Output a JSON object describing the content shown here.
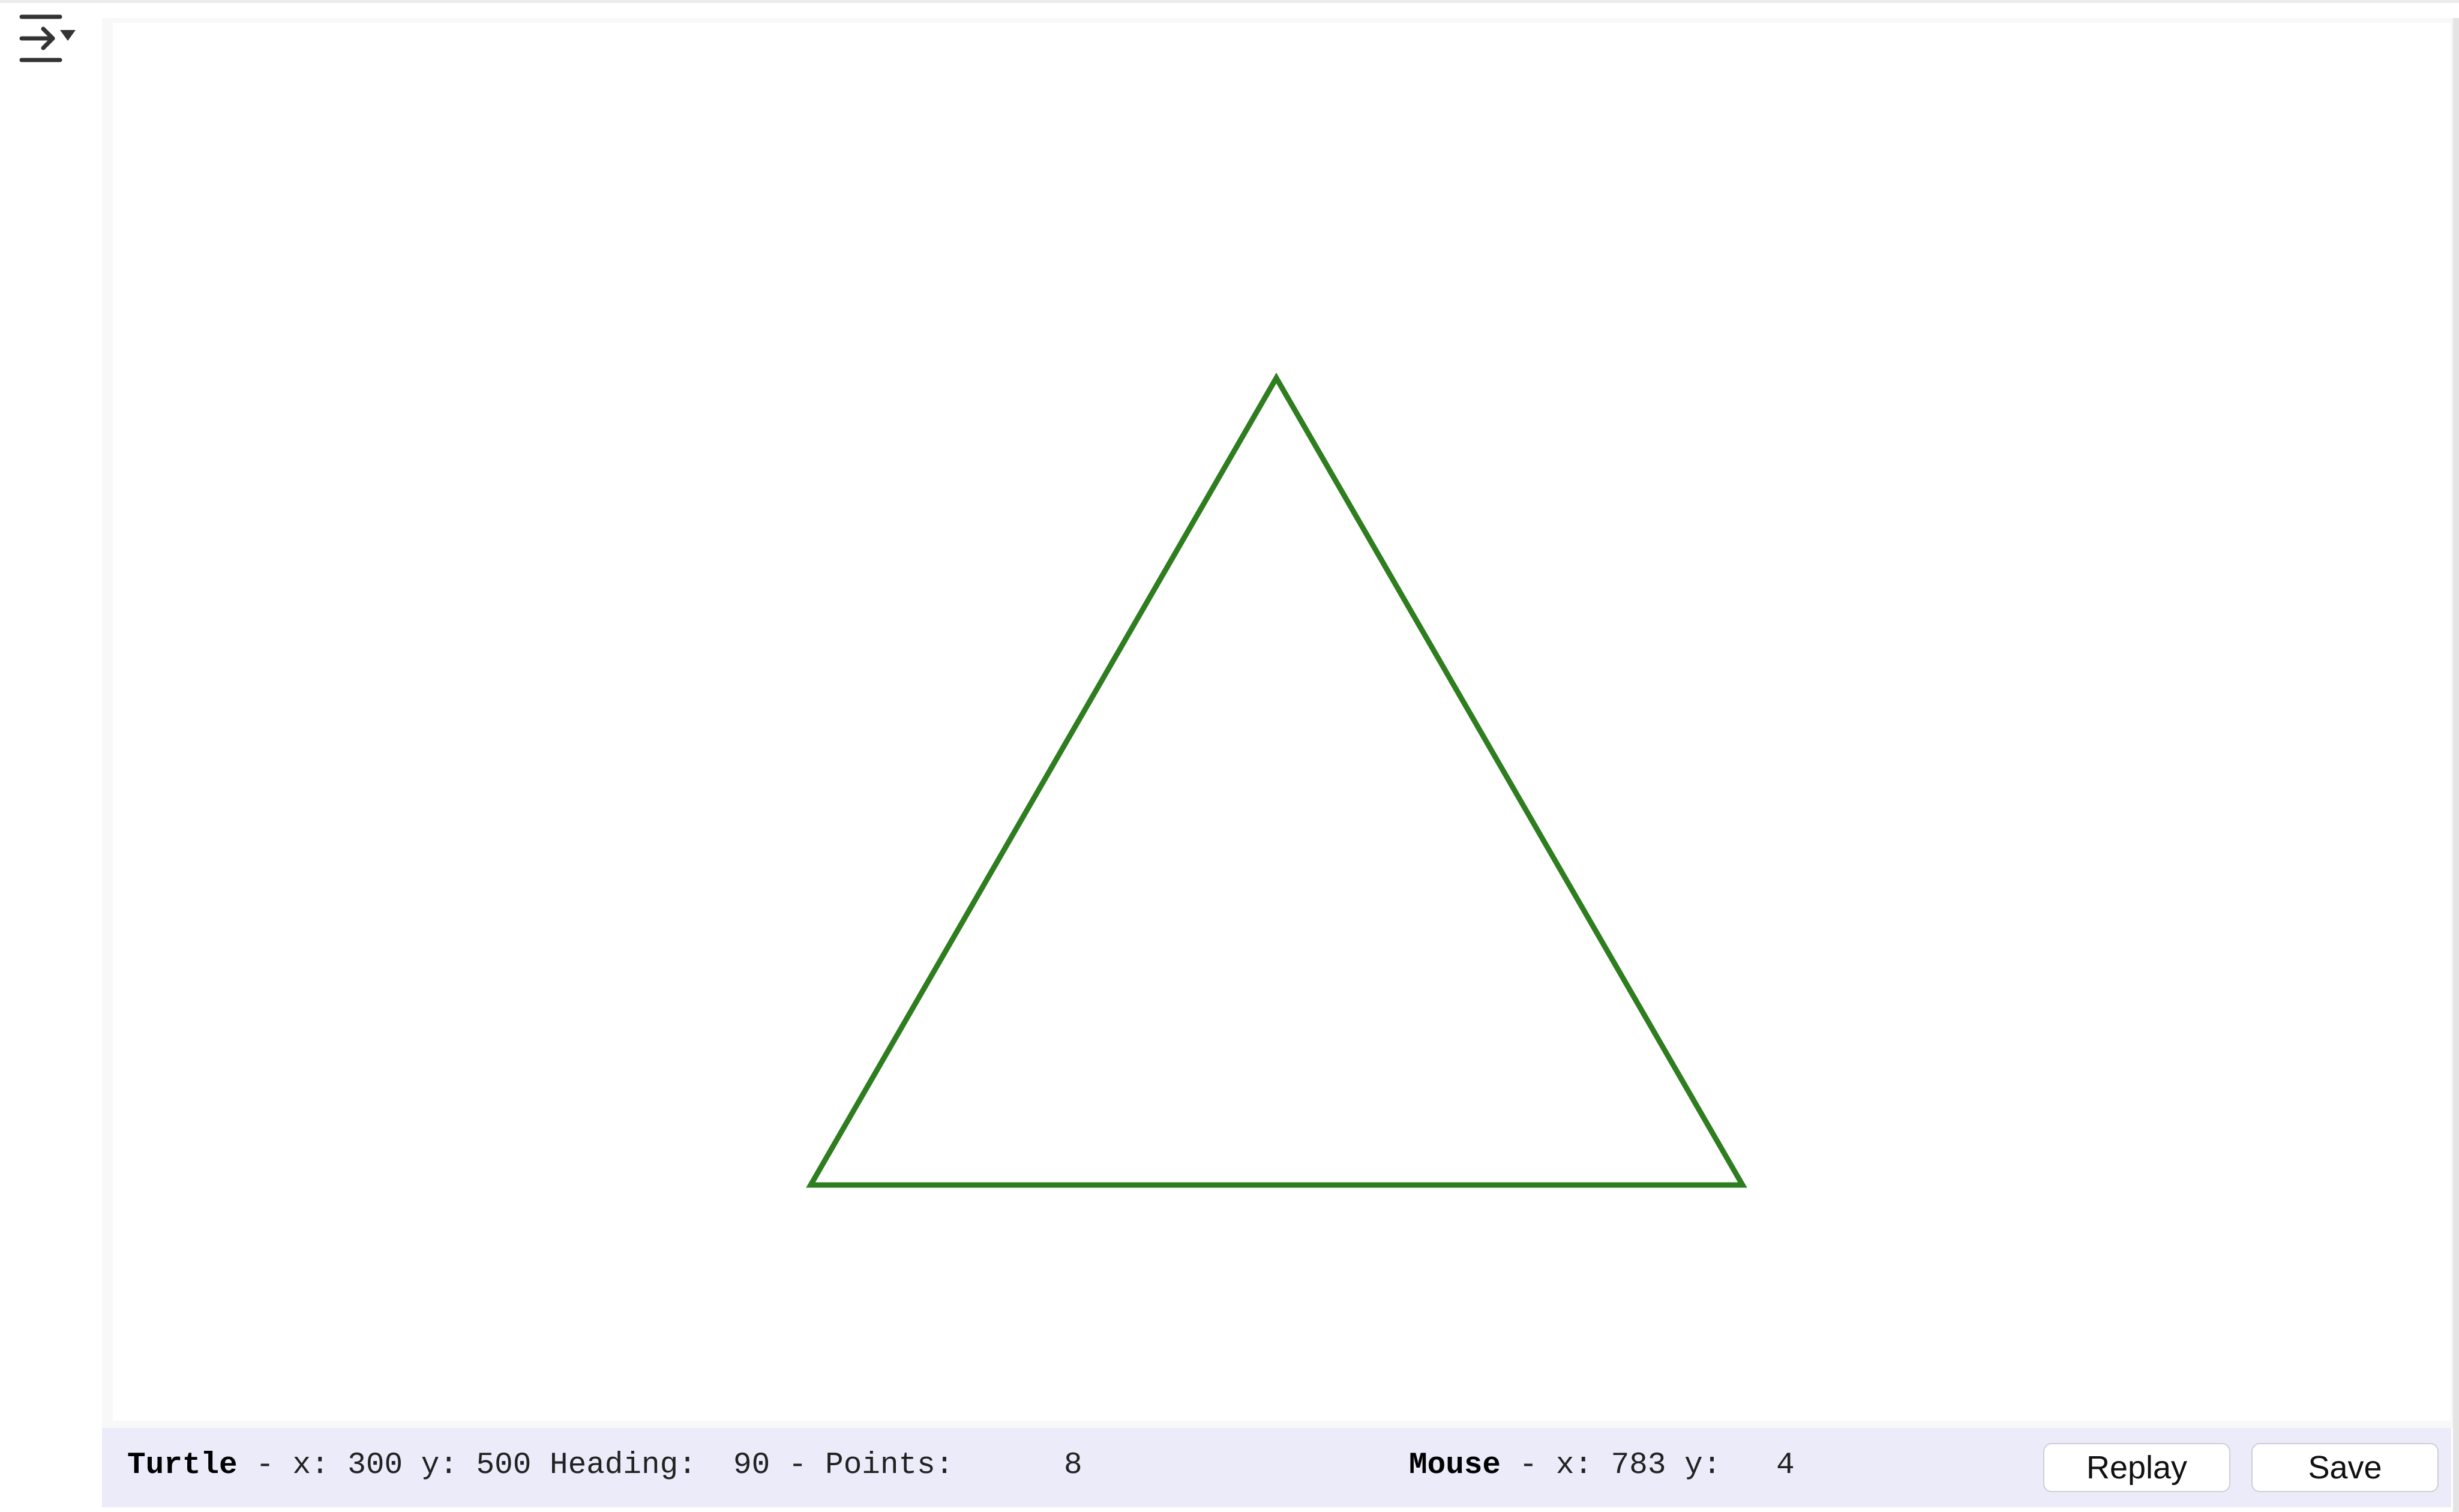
{
  "toolbar": {
    "toggle_icon": "collapse-panel-icon"
  },
  "canvas": {
    "shape": "triangle",
    "stroke_color": "#2e7d1f",
    "background": "#ffffff"
  },
  "status": {
    "turtle_label": "Turtle",
    "turtle_x_label": " - x:",
    "turtle_x": "300",
    "turtle_y_label": "y:",
    "turtle_y": "500",
    "heading_label": "Heading:",
    "heading": "90",
    "points_sep": "- Points:",
    "points": "8",
    "mouse_label": "Mouse",
    "mouse_x_label": " - x:",
    "mouse_x": "783",
    "mouse_y_label": "y:",
    "mouse_y": "4"
  },
  "buttons": {
    "replay_label": "Replay",
    "save_label": "Save"
  },
  "colors": {
    "status_bar_bg": "#ecebfa",
    "stroke": "#2e7d1f"
  }
}
